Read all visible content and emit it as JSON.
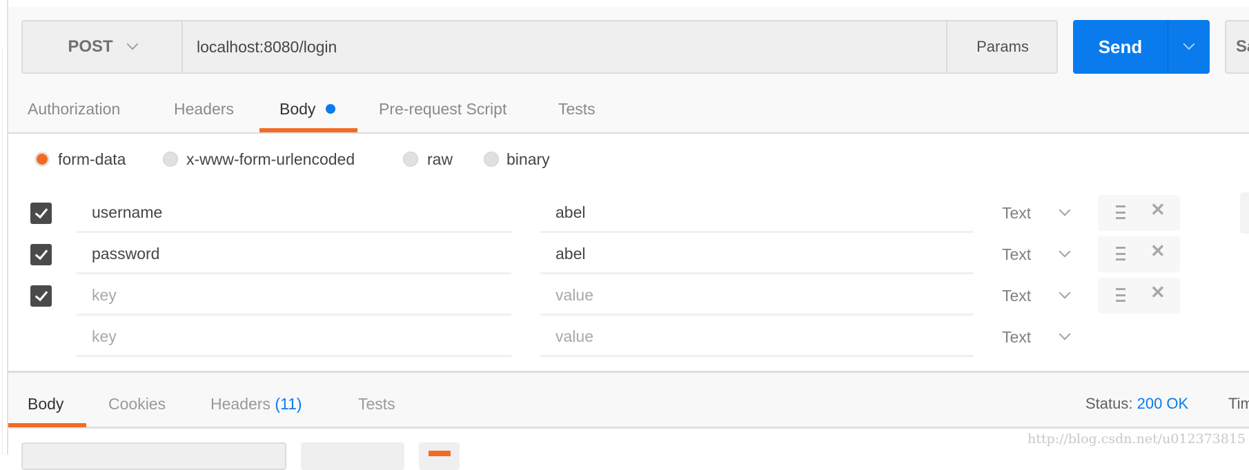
{
  "request": {
    "method": "POST",
    "url": "localhost:8080/login",
    "params_label": "Params",
    "send_label": "Send",
    "save_label": "Sa"
  },
  "request_tabs": [
    {
      "label": "Authorization"
    },
    {
      "label": "Headers"
    },
    {
      "label": "Body",
      "active": true,
      "has_dot": true
    },
    {
      "label": "Pre-request Script"
    },
    {
      "label": "Tests"
    }
  ],
  "body_modes": [
    {
      "label": "form-data",
      "selected": true
    },
    {
      "label": "x-www-form-urlencoded"
    },
    {
      "label": "raw"
    },
    {
      "label": "binary"
    }
  ],
  "form_rows": [
    {
      "checked": true,
      "key": "username",
      "value": "abel",
      "type": "Text"
    },
    {
      "checked": true,
      "key": "password",
      "value": "abel",
      "type": "Text"
    },
    {
      "checked": true,
      "key": "",
      "value": "",
      "key_placeholder": "key",
      "value_placeholder": "value",
      "type": "Text"
    },
    {
      "checked": false,
      "key": "",
      "value": "",
      "key_placeholder": "key",
      "value_placeholder": "value",
      "type": "Text"
    }
  ],
  "response": {
    "tabs": [
      {
        "label": "Body",
        "active": true
      },
      {
        "label": "Cookies"
      },
      {
        "label": "Headers",
        "count": "(11)"
      },
      {
        "label": "Tests"
      }
    ],
    "status_label": "Status:",
    "status_value": "200 OK",
    "time_label": "Tim"
  },
  "watermark": "http://blog.csdn.net/u012373815",
  "colors": {
    "accent": "#f26b23",
    "primary": "#097bed"
  }
}
